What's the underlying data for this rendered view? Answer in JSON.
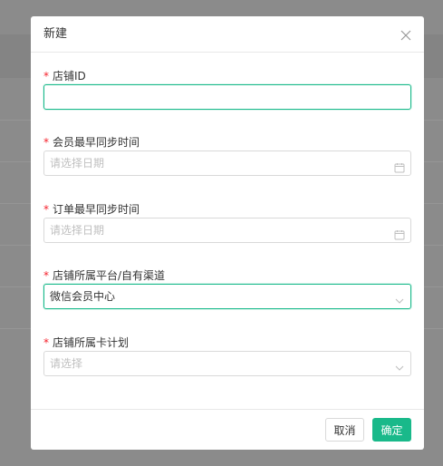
{
  "dialog": {
    "title": "新建",
    "fields": [
      {
        "label": "店铺ID",
        "value": "",
        "placeholder": ""
      },
      {
        "label": "会员最早同步时间",
        "value": "",
        "placeholder": "请选择日期"
      },
      {
        "label": "订单最早同步时间",
        "value": "",
        "placeholder": "请选择日期"
      },
      {
        "label": "店铺所属平台/自有渠道",
        "value": "微信会员中心",
        "placeholder": ""
      },
      {
        "label": "店铺所属卡计划",
        "value": "",
        "placeholder": "请选择"
      }
    ],
    "required_mark": "*",
    "cancel_label": "取消",
    "ok_label": "确定"
  },
  "colors": {
    "accent": "#19b98a",
    "required": "#f5222d"
  },
  "icons": [
    "close-icon",
    "calendar-icon",
    "chevron-down-icon"
  ]
}
